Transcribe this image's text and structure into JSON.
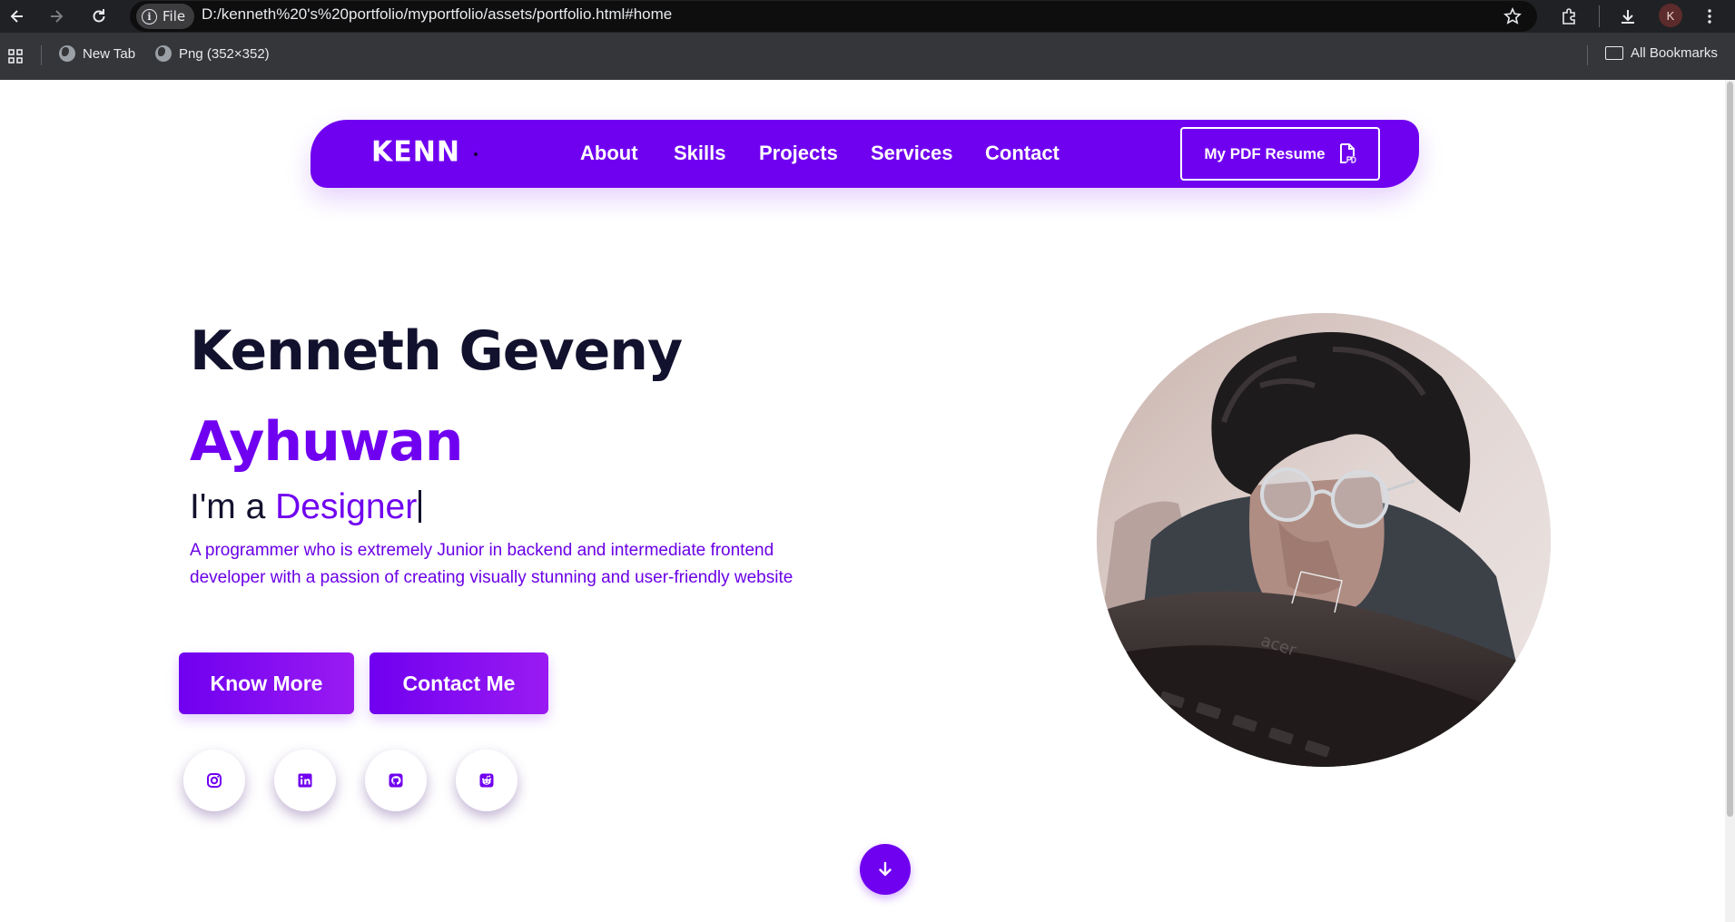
{
  "browser": {
    "url_scheme_label": "File",
    "url": "D:/kenneth%20's%20portfolio/myportfolio/assets/portfolio.html#home",
    "profile_initial": "K",
    "bookmarks": [
      {
        "label": "New Tab"
      },
      {
        "label": "Png (352×352)"
      }
    ],
    "all_bookmarks_label": "All Bookmarks"
  },
  "nav": {
    "logo": "KENN",
    "links": [
      "About",
      "Skills",
      "Projects",
      "Services",
      "Contact"
    ],
    "resume_label": "My PDF Resume"
  },
  "hero": {
    "first_name": "Kenneth Geveny",
    "last_name": "Ayhuwan",
    "typed_prefix": "I'm a ",
    "typed_word": "Designer",
    "description": "A programmer who is extremely Junior in backend and intermediate frontend developer with a passion of creating visually stunning and user-friendly website",
    "buttons": {
      "know_more": "Know More",
      "contact_me": "Contact Me"
    },
    "social_icons": [
      "instagram-icon",
      "linkedin-icon",
      "github-icon",
      "reddit-icon"
    ]
  },
  "colors": {
    "accent": "#7000f0",
    "heading": "#12122e",
    "browser_bg": "#202124",
    "bookmarks_bg": "#35363a"
  }
}
